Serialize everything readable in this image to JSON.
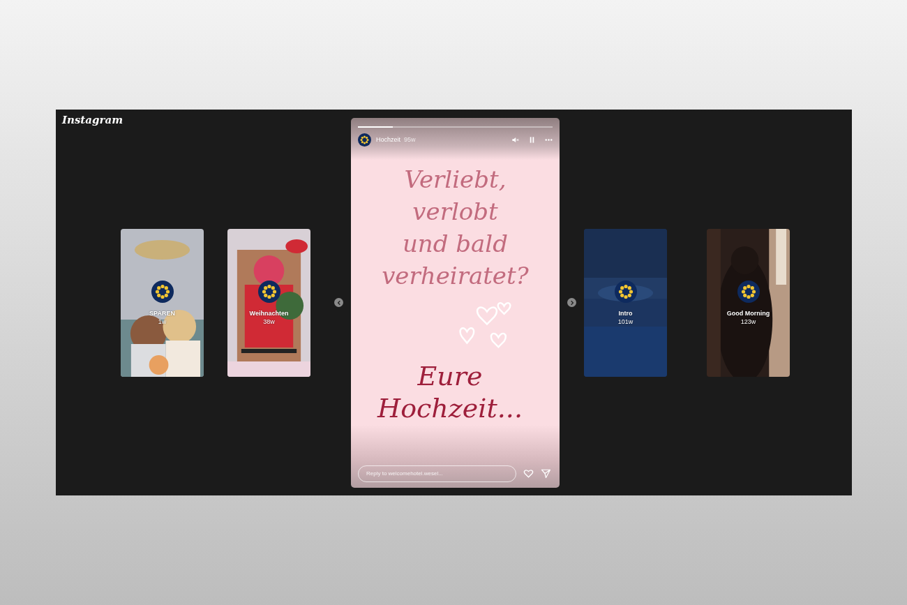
{
  "app": {
    "logo": "Instagram"
  },
  "stories_before": [
    {
      "title": "SPAREN",
      "age": "1w",
      "kind": "picture"
    },
    {
      "title": "Weihnachten",
      "age": "38w",
      "kind": "picture"
    }
  ],
  "current_story": {
    "title": "Hochzeit",
    "age": "95w",
    "progress": [
      {
        "level": 0.18
      }
    ],
    "muted": true,
    "paused": false,
    "text_top": "Verliebt,\nverlobt\nund bald\nverheiratet?",
    "text_bottom": "Eure\nHochzeit...",
    "reply": {
      "placeholder": "Reply to welcomehotel.wesel..."
    }
  },
  "stories_after": [
    {
      "title": "Intro",
      "age": "101w",
      "kind": "picture"
    },
    {
      "title": "Good Morning",
      "age": "123w",
      "kind": "picture"
    }
  ]
}
